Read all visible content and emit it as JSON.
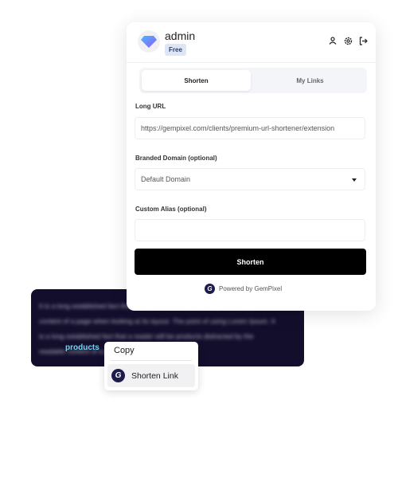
{
  "popup": {
    "user": {
      "name": "admin",
      "plan_badge": "Free"
    },
    "header_icons": [
      "user-icon",
      "gear-icon",
      "logout-icon"
    ],
    "tabs": [
      {
        "label": "Shorten",
        "active": true
      },
      {
        "label": "My Links",
        "active": false
      }
    ],
    "long_url": {
      "label": "Long URL",
      "value": "https://gempixel.com/clients/premium-url-shortener/extension"
    },
    "branded_domain": {
      "label": "Branded Domain (optional)",
      "selected": "Default Domain"
    },
    "custom_alias": {
      "label": "Custom Alias (optional)",
      "value": ""
    },
    "submit_label": "Shorten",
    "powered_by": "Powered by GemPixel"
  },
  "page": {
    "blurred_text": "It is a long established fact that a reader will be distracted by the readable content of a page when looking at its layout. The point of using Lorem Ipsum. It is a long established fact that a reader will be products distracted by the readable content of a page when.",
    "highlighted_word": "products"
  },
  "context_menu": {
    "items": [
      {
        "label": "Copy"
      },
      {
        "label": "Shorten Link"
      }
    ]
  },
  "colors": {
    "accent": "#000000",
    "brand_dark": "#1d1b4a",
    "highlight": "#6fd4f0"
  }
}
